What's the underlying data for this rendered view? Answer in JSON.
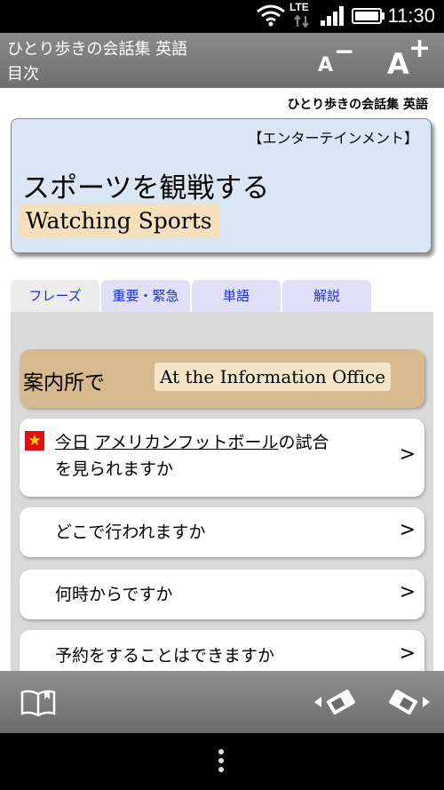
{
  "status": {
    "time": "11:30",
    "network": "LTE"
  },
  "app": {
    "title": "ひとり歩きの会話集 英語",
    "subtitle": "目次",
    "font_decrease": "A",
    "font_decrease_mark": "−",
    "font_increase": "A",
    "font_increase_mark": "+"
  },
  "book_title": "ひとり歩きの会話集 英語",
  "topic": {
    "category": "【エンターテインメント】",
    "title_jp": "スポーツを観戦する",
    "title_en": "Watching Sports"
  },
  "tabs": [
    {
      "label": "フレーズ",
      "active": true
    },
    {
      "label": "重要・緊急",
      "active": false
    },
    {
      "label": "単語",
      "active": false
    },
    {
      "label": "解説",
      "active": false
    }
  ],
  "section": {
    "title_jp": "案内所で",
    "title_en": "At the Information Office"
  },
  "phrases": [
    {
      "parts": [
        "今日",
        " ",
        "アメリカンフットボール",
        "の試合"
      ],
      "line2": "を見られますか",
      "starred": true,
      "arrow": ">"
    },
    {
      "text": "どこで行われますか",
      "arrow": ">"
    },
    {
      "text": "何時からですか",
      "arrow": ">"
    },
    {
      "text": "予約をすることはできますか",
      "arrow": ">"
    }
  ],
  "icons": {
    "wifi": "wifi-icon",
    "signal": "signal-icon",
    "battery": "battery-icon",
    "book": "book-icon",
    "prev": "prev-page-icon",
    "next": "next-page-icon",
    "star": "star-icon",
    "menu": "overflow-menu-icon"
  },
  "colors": {
    "appbar": "#7d7d7d",
    "topic_card": "#dbe6f5",
    "topic_en_bg": "#f6dfbb",
    "tab_text": "#1a2fd6",
    "tab_bg": "#e0e0f8",
    "section_bg": "#d6b98f",
    "star_bg": "#e01010",
    "star_fg": "#ffd400"
  }
}
